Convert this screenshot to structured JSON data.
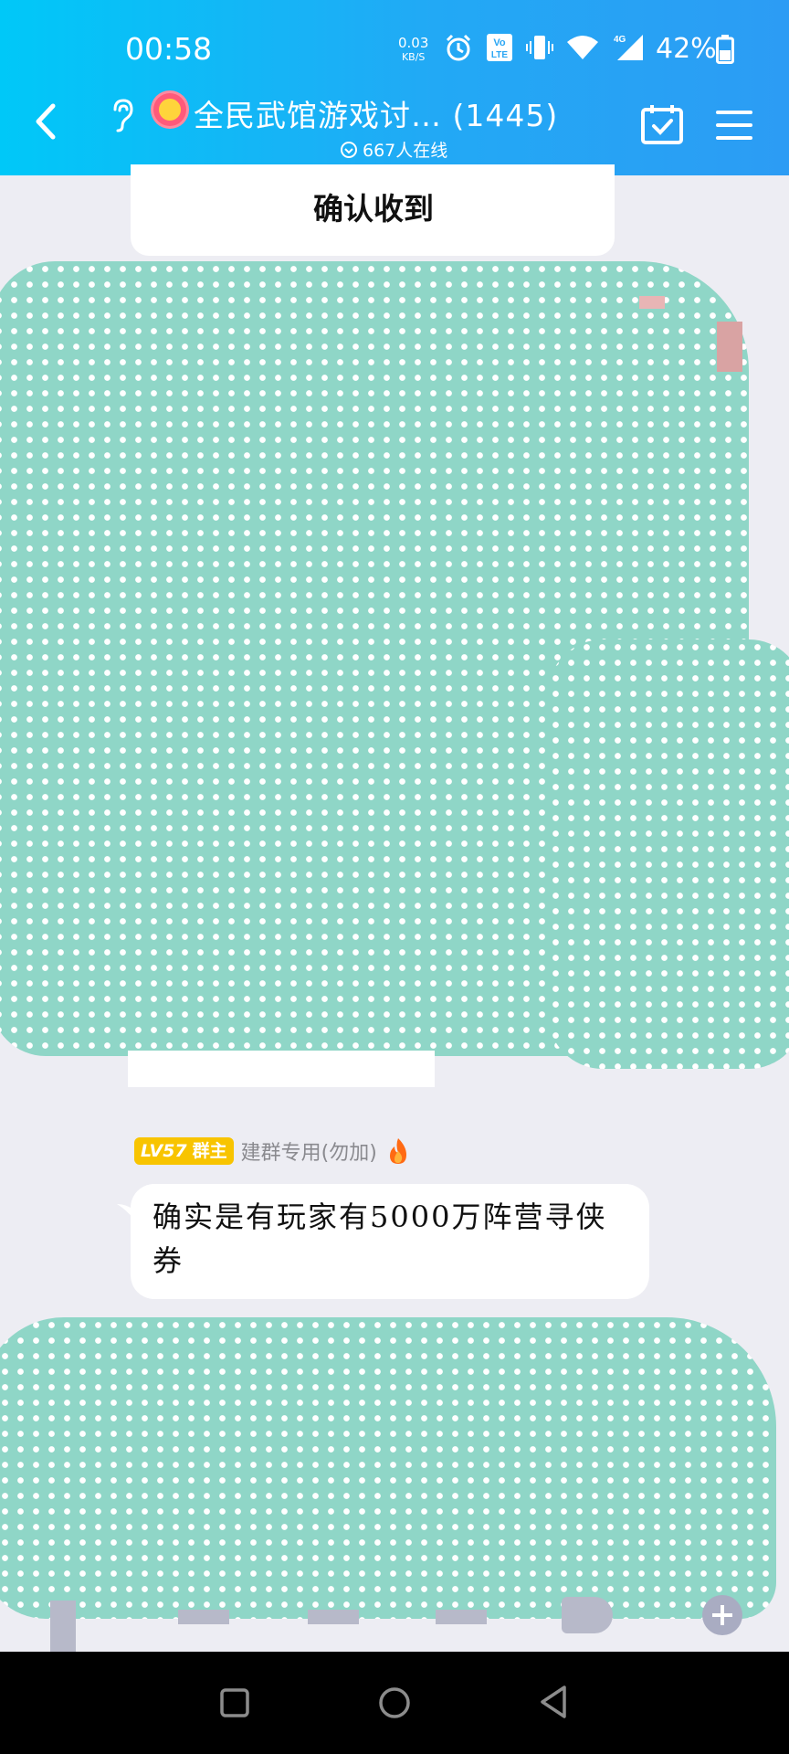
{
  "status_bar": {
    "time": "00:58",
    "net_speed": "0.03",
    "net_unit": "KB/S",
    "battery": "42%",
    "icons": [
      "alarm-icon",
      "volte-icon",
      "vibrate-icon",
      "wifi-icon",
      "4g-signal-icon",
      "battery-icon"
    ]
  },
  "header": {
    "title": "全民武馆游戏讨… (1445)",
    "online_count": "667人在线",
    "icons": [
      "back-arrow-icon",
      "ear-icon",
      "calendar-check-icon",
      "menu-icon"
    ]
  },
  "messages": [
    {
      "type": "partial",
      "text": "确认收到"
    },
    {
      "type": "incoming",
      "level": "LV57",
      "role": "群主",
      "sender": "建群专用(勿加)",
      "text": "确实是有玩家有5000万阵营寻侠券"
    }
  ],
  "colors": {
    "header_start": "#00c8f8",
    "header_end": "#2c9cf4",
    "background": "#ededf3",
    "badge": "#f8c400"
  }
}
